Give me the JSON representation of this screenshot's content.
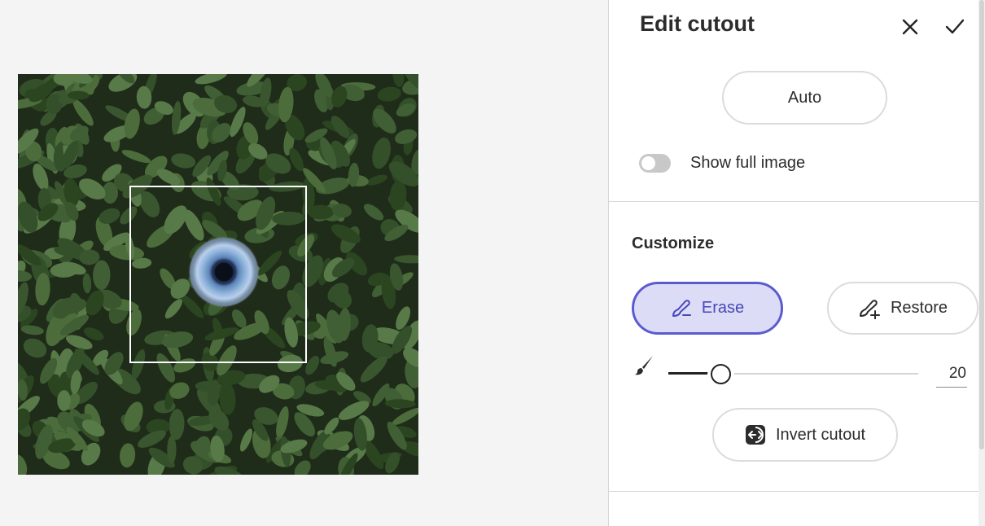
{
  "panel": {
    "title": "Edit cutout",
    "close_icon": "close-icon",
    "confirm_icon": "checkmark-icon",
    "auto_label": "Auto",
    "show_full_image": {
      "label": "Show full image",
      "checked": false
    }
  },
  "customize": {
    "title": "Customize",
    "erase": {
      "label": "Erase",
      "icon": "brush-minus-icon",
      "active": true
    },
    "restore": {
      "label": "Restore",
      "icon": "brush-plus-icon",
      "active": false
    },
    "brush_size": {
      "icon": "brush-icon",
      "value": "20",
      "fraction": 0.21
    },
    "invert_label": "Invert cutout",
    "invert_icon": "invert-icon"
  },
  "colors": {
    "accent": "#5b5bd0",
    "accent_bg": "#dcdcf7",
    "canvas_bg": "#f4f4f4"
  }
}
